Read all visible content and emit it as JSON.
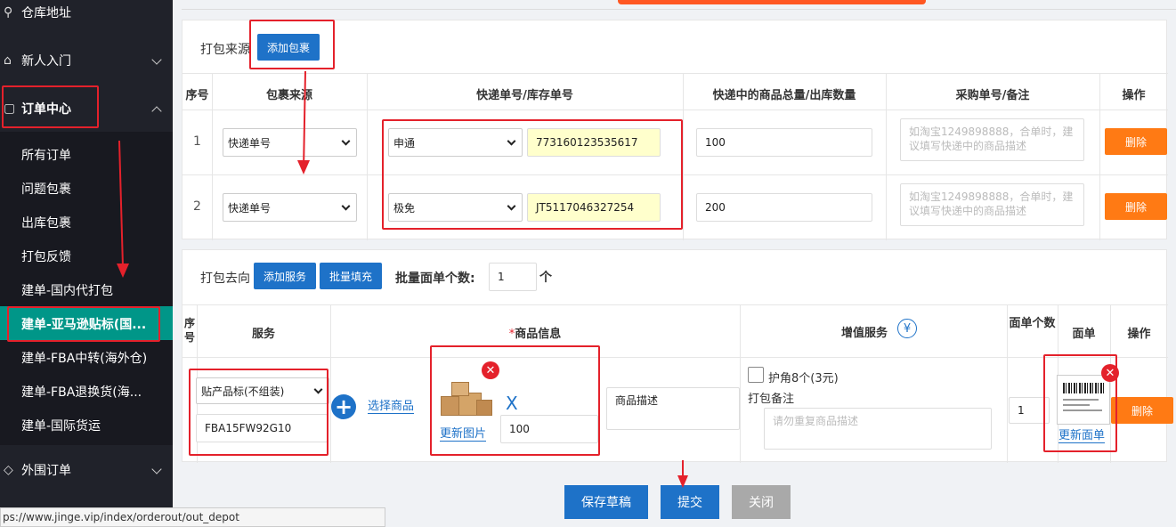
{
  "sidebar": {
    "warehouse_address": "仓库地址",
    "newbie": "新人入门",
    "order_center": "订单中心",
    "sub_items": [
      "所有订单",
      "问题包裹",
      "出库包裹",
      "打包反馈",
      "建单-国内代打包",
      "建单-亚马逊贴标(国...",
      "建单-FBA中转(海外仓)",
      "建单-FBA退换货(海...",
      "建单-国际货运"
    ],
    "external_orders": "外围订单"
  },
  "source_section": {
    "title": "打包来源",
    "add_package_button": "添加包裹",
    "headers": [
      "序号",
      "包裹来源",
      "快递单号/库存单号",
      "快递中的商品总量/出库数量",
      "采购单号/备注",
      "操作"
    ],
    "rows": [
      {
        "index": "1",
        "source": "快递单号",
        "carrier": "申通",
        "tracking": "773160123535617",
        "quantity": "100",
        "remark_placeholder": "如淘宝1249898888，合单时，建议填写快递中的商品描述",
        "delete": "删除"
      },
      {
        "index": "2",
        "source": "快递单号",
        "carrier": "极免",
        "tracking": "JT5117046327254",
        "quantity": "200",
        "remark_placeholder": "如淘宝1249898888，合单时，建议填写快递中的商品描述",
        "delete": "删除"
      }
    ]
  },
  "dest_section": {
    "title": "打包去向",
    "add_service_button": "添加服务",
    "batch_fill_button": "批量填充",
    "batch_label": "批量面单个数:",
    "batch_value": "1",
    "batch_unit": "个",
    "headers": {
      "index": "序号",
      "service": "服务",
      "required_mark": "*",
      "product_info": "商品信息",
      "value_added": "增值服务",
      "yen_icon": "¥",
      "label_count": "面单个数",
      "label": "面单",
      "action": "操作"
    },
    "row": {
      "service_select": "贴产品标(不组装)",
      "sku": "FBA15FW92G10",
      "select_product": "选择商品",
      "update_image": "更新图片",
      "multiply": "X",
      "qty": "100",
      "product_desc": "商品描述",
      "corner_protect": "护角8个(3元)",
      "pack_remark_label": "打包备注",
      "pack_remark_placeholder": "请勿重复商品描述",
      "label_count": "1",
      "update_label": "更新面单",
      "delete": "删除"
    }
  },
  "footer": {
    "save_draft": "保存草稿",
    "submit": "提交",
    "close": "关闭"
  },
  "status_url": "ps://www.jinge.vip/index/orderout/out_depot",
  "colors": {
    "sidebar": "#20222a",
    "active": "#009688",
    "primary": "#1e72c8",
    "danger": "#ff7a14",
    "annotation": "#e4212b"
  }
}
